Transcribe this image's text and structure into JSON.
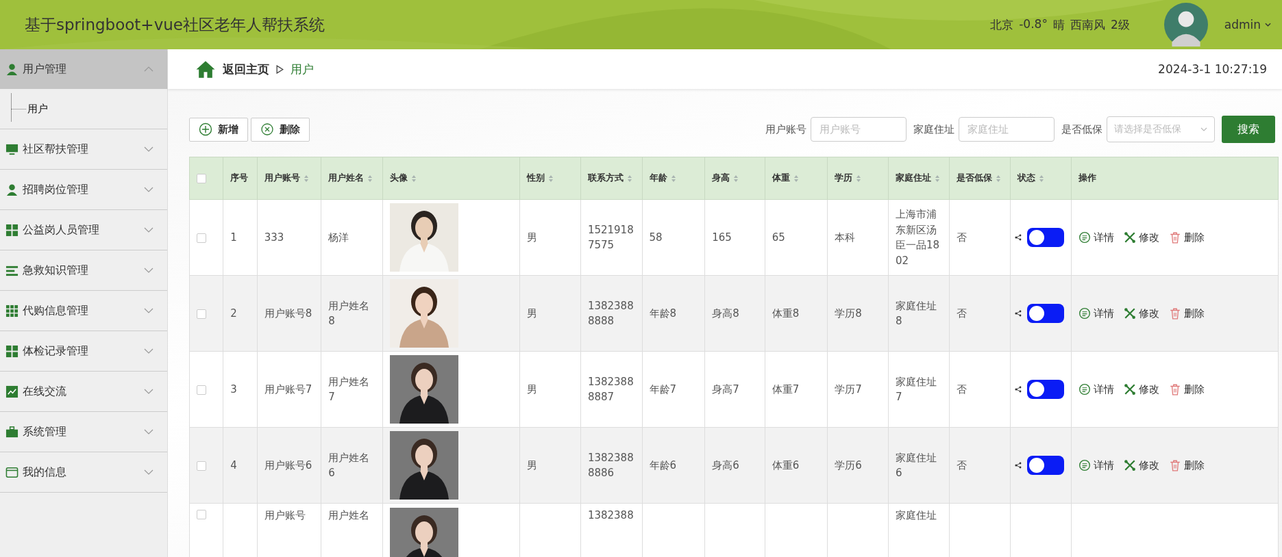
{
  "header": {
    "title": "基于springboot+vue社区老年人帮扶系统",
    "weather": [
      "北京",
      "-0.8°",
      "晴",
      "西南风",
      "2级"
    ],
    "user": "admin"
  },
  "sidebar": {
    "items": [
      {
        "label": "用户管理",
        "expanded": true,
        "selected": true,
        "children": [
          {
            "label": "用户",
            "selected": true
          }
        ]
      },
      {
        "label": "社区帮扶管理",
        "expanded": false,
        "selected": false
      },
      {
        "label": "招聘岗位管理",
        "expanded": false,
        "selected": false
      },
      {
        "label": "公益岗人员管理",
        "expanded": false,
        "selected": false
      },
      {
        "label": "急救知识管理",
        "expanded": false,
        "selected": false
      },
      {
        "label": "代购信息管理",
        "expanded": false,
        "selected": false
      },
      {
        "label": "体检记录管理",
        "expanded": false,
        "selected": false
      },
      {
        "label": "在线交流",
        "expanded": false,
        "selected": false
      },
      {
        "label": "系统管理",
        "expanded": false,
        "selected": false
      },
      {
        "label": "我的信息",
        "expanded": false,
        "selected": false
      }
    ]
  },
  "breadcrumb": {
    "home": "返回主页",
    "current": "用户"
  },
  "datetime": "2024-3-1 10:27:19",
  "toolbar": {
    "buttons": [
      {
        "kind": "add",
        "label": "新增"
      },
      {
        "kind": "delete",
        "label": "删除"
      }
    ],
    "filters": [
      {
        "kind": "input",
        "label": "用户账号",
        "placeholder": "用户账号"
      },
      {
        "kind": "input",
        "label": "家庭住址",
        "placeholder": "家庭住址"
      },
      {
        "kind": "select",
        "label": "是否低保",
        "placeholder": "请选择是否低保"
      }
    ],
    "search": "搜索"
  },
  "table": {
    "select_all": false,
    "columns": [
      {
        "label": "序号",
        "sortable": false
      },
      {
        "label": "用户账号",
        "sortable": true
      },
      {
        "label": "用户姓名",
        "sortable": true
      },
      {
        "label": "头像",
        "sortable": true
      },
      {
        "label": "性别",
        "sortable": true
      },
      {
        "label": "联系方式",
        "sortable": true
      },
      {
        "label": "年龄",
        "sortable": true
      },
      {
        "label": "身高",
        "sortable": true
      },
      {
        "label": "体重",
        "sortable": true
      },
      {
        "label": "学历",
        "sortable": true
      },
      {
        "label": "家庭住址",
        "sortable": true
      },
      {
        "label": "是否低保",
        "sortable": true
      },
      {
        "label": "状态",
        "sortable": true
      },
      {
        "label": "操作",
        "sortable": false
      }
    ],
    "rows": [
      {
        "checked": false,
        "cells": [
          "1",
          "333",
          "杨洋",
          null,
          "男",
          "15219187575",
          "58",
          "165",
          "65",
          "本科",
          "上海市浦东新区汤臣一品1802",
          "否"
        ],
        "status_on": false,
        "actions": [
          "详情",
          "修改",
          "删除"
        ]
      },
      {
        "checked": false,
        "cells": [
          "2",
          "用户账号8",
          "用户姓名8",
          null,
          "男",
          "13823888888",
          "年龄8",
          "身高8",
          "体重8",
          "学历8",
          "家庭住址8",
          "否"
        ],
        "status_on": false,
        "actions": [
          "详情",
          "修改",
          "删除"
        ]
      },
      {
        "checked": false,
        "cells": [
          "3",
          "用户账号7",
          "用户姓名7",
          null,
          "男",
          "13823888887",
          "年龄7",
          "身高7",
          "体重7",
          "学历7",
          "家庭住址7",
          "否"
        ],
        "status_on": false,
        "actions": [
          "详情",
          "修改",
          "删除"
        ]
      },
      {
        "checked": false,
        "cells": [
          "4",
          "用户账号6",
          "用户姓名6",
          null,
          "男",
          "13823888886",
          "年龄6",
          "身高6",
          "体重6",
          "学历6",
          "家庭住址6",
          "否"
        ],
        "status_on": false,
        "actions": [
          "详情",
          "修改",
          "删除"
        ]
      },
      {
        "checked": false,
        "cells": [
          null,
          "用户账号",
          "用户姓名",
          null,
          null,
          "1382388",
          null,
          null,
          null,
          null,
          "家庭住址",
          null
        ]
      }
    ]
  }
}
